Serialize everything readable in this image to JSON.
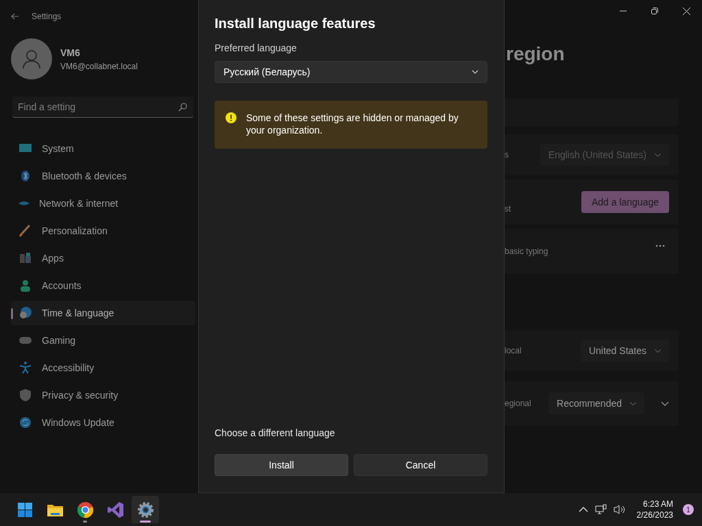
{
  "window": {
    "title": "Settings"
  },
  "user": {
    "name": "VM6",
    "email": "VM6@collabnet.local"
  },
  "search": {
    "placeholder": "Find a setting"
  },
  "sidebar": {
    "items": [
      {
        "label": "System",
        "kind": "system",
        "selected": false
      },
      {
        "label": "Bluetooth & devices",
        "kind": "bluetooth",
        "selected": false
      },
      {
        "label": "Network & internet",
        "kind": "network",
        "selected": false
      },
      {
        "label": "Personalization",
        "kind": "brush",
        "selected": false
      },
      {
        "label": "Apps",
        "kind": "apps",
        "selected": false
      },
      {
        "label": "Accounts",
        "kind": "accounts",
        "selected": false
      },
      {
        "label": "Time & language",
        "kind": "time",
        "selected": true
      },
      {
        "label": "Gaming",
        "kind": "gaming",
        "selected": false
      },
      {
        "label": "Accessibility",
        "kind": "accessibility",
        "selected": false
      },
      {
        "label": "Privacy & security",
        "kind": "shield",
        "selected": false
      },
      {
        "label": "Windows Update",
        "kind": "update",
        "selected": false
      }
    ]
  },
  "page": {
    "heading": "region",
    "cards": [
      {
        "kind": "blank"
      },
      {
        "kind": "dropdown",
        "label": "s",
        "value": "English (United States)",
        "disabled": true
      },
      {
        "kind": "button",
        "label": "st",
        "button": "Add a language"
      },
      {
        "kind": "more",
        "label": "basic typing"
      },
      {
        "kind": "gap"
      },
      {
        "kind": "dropdown",
        "label": "local",
        "value": "United States",
        "disabled": false
      },
      {
        "kind": "expand",
        "label": "egional",
        "value": "Recommended",
        "disabled": false
      }
    ]
  },
  "dialog": {
    "title": "Install language features",
    "field_label": "Preferred language",
    "select_value": "Русский (Беларусь)",
    "warning": "Some of these settings are hidden or managed by your organization.",
    "link": "Choose a different language",
    "buttons": [
      {
        "label": "Install",
        "hovered": true
      },
      {
        "label": "Cancel",
        "hovered": false
      }
    ]
  },
  "taskbar": {
    "apps": [
      {
        "kind": "start",
        "running": false,
        "selected": false
      },
      {
        "kind": "folder",
        "running": false,
        "selected": false
      },
      {
        "kind": "browser",
        "running": true,
        "selected": false
      },
      {
        "kind": "ide",
        "running": false,
        "selected": false
      },
      {
        "kind": "settings",
        "running": true,
        "selected": true
      }
    ],
    "time": "6:23 AM",
    "date": "2/26/2023",
    "notifications": "1"
  }
}
